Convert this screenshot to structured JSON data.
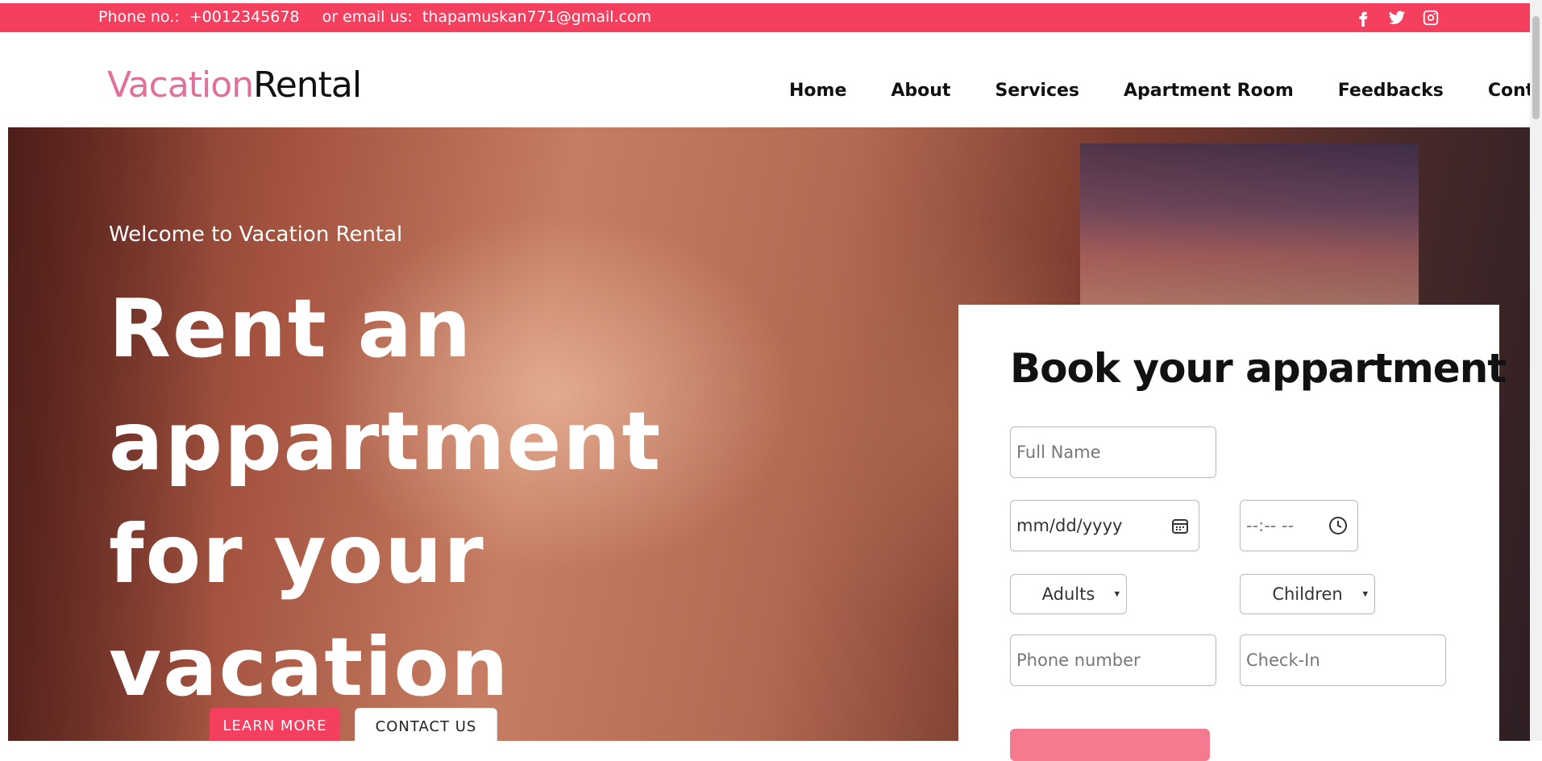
{
  "topbar": {
    "phone_label": "Phone no.:",
    "phone": "+0012345678",
    "email_label": "or email us:",
    "email": "thapamuskan771@gmail.com",
    "socials": [
      "facebook-icon",
      "twitter-icon",
      "instagram-icon"
    ]
  },
  "brand": {
    "part1": "Vacation",
    "part2": "Rental",
    "accent": "#e0719b"
  },
  "nav": [
    "Home",
    "About",
    "Services",
    "Apartment Room",
    "Feedbacks",
    "Contact"
  ],
  "hero": {
    "welcome": "Welcome to Vacation Rental",
    "headline": "Rent an appartment for your vacation",
    "learn_more": "LEARN MORE",
    "contact_us": "CONTACT US"
  },
  "booking": {
    "title": "Book your appartment",
    "full_name_placeholder": "Full Name",
    "date_placeholder": "mm/dd/yyyy",
    "time_placeholder": "--:-- --",
    "adults": "Adults",
    "children": "Children",
    "phone_placeholder": "Phone number",
    "checkin_placeholder": "Check-In"
  },
  "colors": {
    "primary": "#f43f5e",
    "brand_pink": "#e0719b"
  }
}
